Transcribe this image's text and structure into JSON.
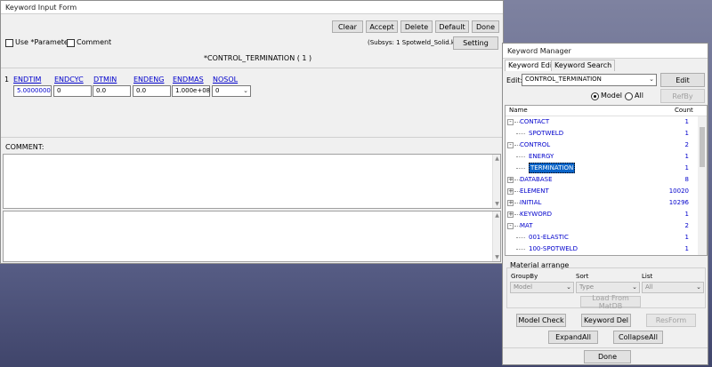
{
  "kif": {
    "title": "Keyword Input Form",
    "buttons": {
      "clear": "Clear",
      "accept": "Accept",
      "delete": "Delete",
      "default": "Default",
      "done": "Done",
      "setting": "Setting"
    },
    "use_parameter": "Use *Parameter",
    "comment_check": "Comment",
    "subsys": "(Subsys: 1 Spotweld_Solid.k)",
    "keyword_title": "*CONTROL_TERMINATION    ( 1 )",
    "row_index": "1",
    "fields": [
      {
        "label": "ENDTIM",
        "value": "5.0000000"
      },
      {
        "label": "ENDCYC",
        "value": "0"
      },
      {
        "label": "DTMIN",
        "value": "0.0"
      },
      {
        "label": "ENDENG",
        "value": "0.0"
      },
      {
        "label": "ENDMAS",
        "value": "1.000e+08"
      },
      {
        "label": "NOSOL",
        "value": "0"
      }
    ],
    "comment_label": "COMMENT:"
  },
  "km": {
    "title": "Keyword Manager",
    "tabs": [
      "Keyword Edit",
      "Keyword Search"
    ],
    "edit_label": "Edit:",
    "edit_value": "CONTROL_TERMINATION",
    "edit_button": "Edit",
    "radio_model": "Model",
    "radio_all": "All",
    "refby": "RefBy",
    "col_name": "Name",
    "col_count": "Count",
    "tree": [
      {
        "name": "CONTACT",
        "count": "1",
        "level": 0,
        "exp": "-"
      },
      {
        "name": "SPOTWELD",
        "count": "1",
        "level": 1,
        "exp": ""
      },
      {
        "name": "CONTROL",
        "count": "2",
        "level": 0,
        "exp": "-"
      },
      {
        "name": "ENERGY",
        "count": "1",
        "level": 1,
        "exp": ""
      },
      {
        "name": "TERMINATION",
        "count": "1",
        "level": 1,
        "exp": "",
        "selected": true
      },
      {
        "name": "DATABASE",
        "count": "8",
        "level": 0,
        "exp": "+"
      },
      {
        "name": "ELEMENT",
        "count": "10020",
        "level": 0,
        "exp": "+"
      },
      {
        "name": "INITIAL",
        "count": "10296",
        "level": 0,
        "exp": "+"
      },
      {
        "name": "KEYWORD",
        "count": "1",
        "level": 0,
        "exp": "+"
      },
      {
        "name": "MAT",
        "count": "2",
        "level": 0,
        "exp": "-"
      },
      {
        "name": "001-ELASTIC",
        "count": "1",
        "level": 1,
        "exp": ""
      },
      {
        "name": "100-SPOTWELD",
        "count": "1",
        "level": 1,
        "exp": ""
      }
    ],
    "material_arrange": "Material arrange",
    "groupby_label": "GroupBy",
    "sort_label": "Sort",
    "list_label": "List",
    "groupby_value": "Model",
    "sort_value": "Type",
    "list_value": "All",
    "load_matdb": "Load From MatDB",
    "model_check": "Model Check",
    "keyword_del": "Keyword Del",
    "resform": "ResForm",
    "expand_all": "ExpandAll",
    "collapse_all": "CollapseAll",
    "done": "Done"
  }
}
